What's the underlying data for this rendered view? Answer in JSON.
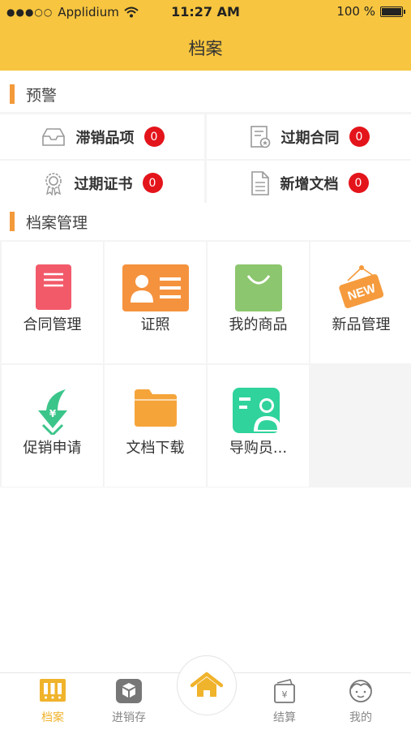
{
  "status_bar": {
    "carrier": "Applidium",
    "time": "11:27 AM",
    "battery": "100 %"
  },
  "nav": {
    "title": "档案"
  },
  "warning": {
    "title": "预警",
    "items": [
      {
        "label": "滞销品项",
        "count": "0",
        "icon": "inbox-tray-icon"
      },
      {
        "label": "过期合同",
        "count": "0",
        "icon": "contract-icon"
      },
      {
        "label": "过期证书",
        "count": "0",
        "icon": "certificate-icon"
      },
      {
        "label": "新增文档",
        "count": "0",
        "icon": "document-icon"
      }
    ]
  },
  "archive": {
    "title": "档案管理",
    "items": [
      {
        "label": "合同管理",
        "icon": "contract-book-icon",
        "color": "#f25a6a"
      },
      {
        "label": "证照",
        "icon": "id-card-icon",
        "color": "#f5923e"
      },
      {
        "label": "我的商品",
        "icon": "shopping-bag-icon",
        "color": "#8cc66e"
      },
      {
        "label": "新品管理",
        "icon": "new-tag-icon",
        "color": "#f59b3d"
      },
      {
        "label": "促销申请",
        "icon": "yuan-download-icon",
        "color": "#3cc58a"
      },
      {
        "label": "文档下载",
        "icon": "folder-icon",
        "color": "#f5a43a"
      },
      {
        "label": "导购员...",
        "icon": "staff-card-icon",
        "color": "#2fd39b"
      }
    ]
  },
  "tabbar": {
    "tabs": [
      {
        "label": "档案",
        "icon": "archive-icon",
        "active": true
      },
      {
        "label": "进销存",
        "icon": "inventory-icon",
        "active": false
      },
      {
        "label": "",
        "icon": "home-icon",
        "active": false
      },
      {
        "label": "结算",
        "icon": "wallet-icon",
        "active": false
      },
      {
        "label": "我的",
        "icon": "profile-icon",
        "active": false
      }
    ]
  },
  "colors": {
    "brand": "#f7c53f",
    "accent_bar": "#f39a3a",
    "badge": "#e4141b",
    "active_tab": "#f0b32c"
  }
}
